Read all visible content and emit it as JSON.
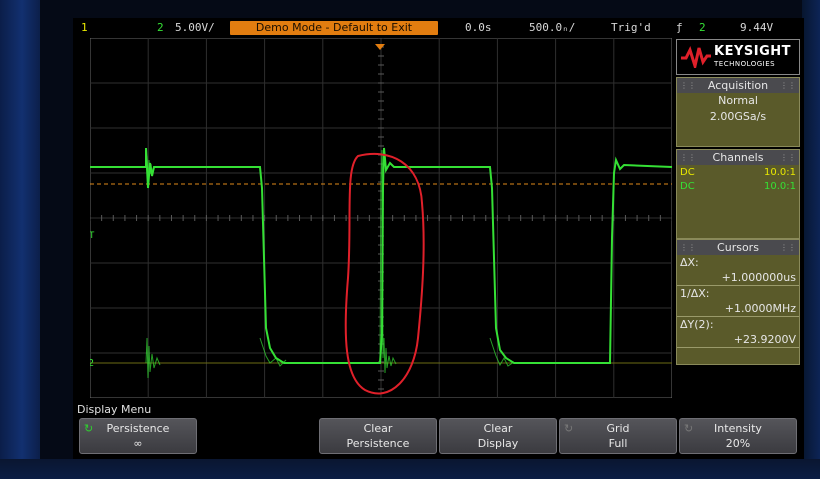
{
  "status_bar": {
    "ch1_number": "1",
    "ch2_number": "2",
    "ch2_scale": "5.00V/",
    "demo_banner": "Demo Mode - Default to Exit",
    "time_delay": "0.0s",
    "timebase": "500.0ₙ/",
    "trigger_state": "Trig'd",
    "trigger_slope": "ƒ",
    "trigger_source": "2",
    "trigger_level": "9.44V"
  },
  "logo": {
    "name": "KEYSIGHT",
    "subtitle": "TECHNOLOGIES"
  },
  "acquisition": {
    "title": "Acquisition",
    "mode": "Normal",
    "sample_rate": "2.00GSa/s"
  },
  "channels": {
    "title": "Channels",
    "rows": [
      {
        "coupling": "DC",
        "probe": "10.0:1",
        "color": "#e8e800"
      },
      {
        "coupling": "DC",
        "probe": "10.0:1",
        "color": "#35e035"
      }
    ]
  },
  "cursors": {
    "title": "Cursors",
    "dx_label": "ΔX:",
    "dx_value": "+1.000000us",
    "inv_dx_label": "1/ΔX:",
    "inv_dx_value": "+1.0000MHz",
    "dy_label": "ΔY(2):",
    "dy_value": "+23.9200V"
  },
  "waveform_markers": {
    "trigger_marker": "T",
    "ch2_ground_marker": "2"
  },
  "softkeys": {
    "menu_title": "Display Menu",
    "items": [
      {
        "line1": "Persistence",
        "line2": "∞",
        "knob": "active"
      },
      {
        "line1": "Clear",
        "line2": "Persistence",
        "knob": "none"
      },
      {
        "line1": "Clear",
        "line2": "Display",
        "knob": "none"
      },
      {
        "line1": "Grid",
        "line2": "Full",
        "knob": "inactive"
      },
      {
        "line1": "Intensity",
        "line2": "20%",
        "knob": "inactive"
      }
    ]
  },
  "colors": {
    "channel1": "#e8e800",
    "channel2": "#35e035",
    "banner": "#e27d10",
    "annotation_ring": "#e0202a",
    "panel_bg": "#5a5a2a"
  }
}
